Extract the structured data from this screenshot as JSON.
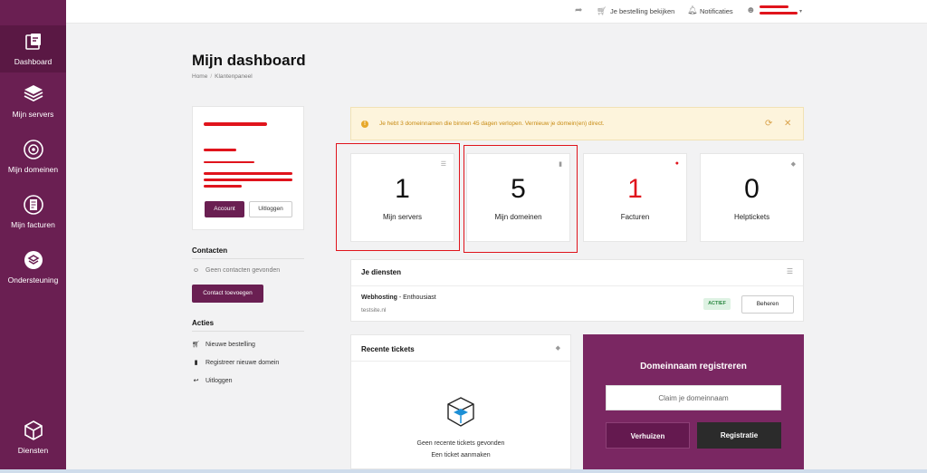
{
  "sidebar": {
    "items": [
      {
        "label": "Dashboard",
        "icon": "dashboard-icon"
      },
      {
        "label": "Mijn servers",
        "icon": "server-icon"
      },
      {
        "label": "Mijn domeinen",
        "icon": "globe-icon"
      },
      {
        "label": "Mijn facturen",
        "icon": "invoice-icon"
      },
      {
        "label": "Ondersteuning",
        "icon": "support-icon"
      },
      {
        "label": "Diensten",
        "icon": "box-icon"
      }
    ]
  },
  "topbar": {
    "order_label": "Je bestelling bekijken",
    "notifications_label": "Notificaties"
  },
  "page": {
    "title": "Mijn dashboard",
    "breadcrumb": [
      "Home",
      "Klantenpaneel"
    ]
  },
  "profile": {
    "account_button": "Account",
    "logout_button": "Uitloggen"
  },
  "contacts": {
    "title": "Contacten",
    "empty": "Geen contacten gevonden",
    "add_button": "Contact toevoegen"
  },
  "actions": {
    "title": "Acties",
    "items": [
      {
        "label": "Nieuwe bestelling",
        "icon": "cart-icon"
      },
      {
        "label": "Registreer nieuwe domein",
        "icon": "tag-icon"
      },
      {
        "label": "Uitloggen",
        "icon": "logout-arrow-icon"
      }
    ]
  },
  "alert": {
    "text": "Je hebt 3 domeinnamen die binnen 45 dagen verlopen. Vernieuw je domein(en) direct."
  },
  "stats": [
    {
      "value": "1",
      "label": "Mijn servers"
    },
    {
      "value": "5",
      "label": "Mijn domeinen"
    },
    {
      "value": "1",
      "label": "Facturen"
    },
    {
      "value": "0",
      "label": "Helptickets"
    }
  ],
  "services": {
    "title": "Je diensten",
    "items": [
      {
        "product": "Webhosting",
        "plan": " - Enthousiast",
        "domain": "testsite.nl",
        "status": "ACTIEF",
        "action": "Beheren"
      }
    ]
  },
  "tickets": {
    "title": "Recente tickets",
    "empty": "Geen recente tickets gevonden",
    "new": "Een ticket aanmaken"
  },
  "domain_register": {
    "title": "Domeinnaam registreren",
    "placeholder": "Claim je domeinnaam",
    "transfer_button": "Verhuizen",
    "register_button": "Registratie"
  },
  "colors": {
    "brand": "#6a1f52",
    "danger": "#e0141c",
    "warning_bg": "#fdf4dc",
    "success": "#2f8a45"
  }
}
